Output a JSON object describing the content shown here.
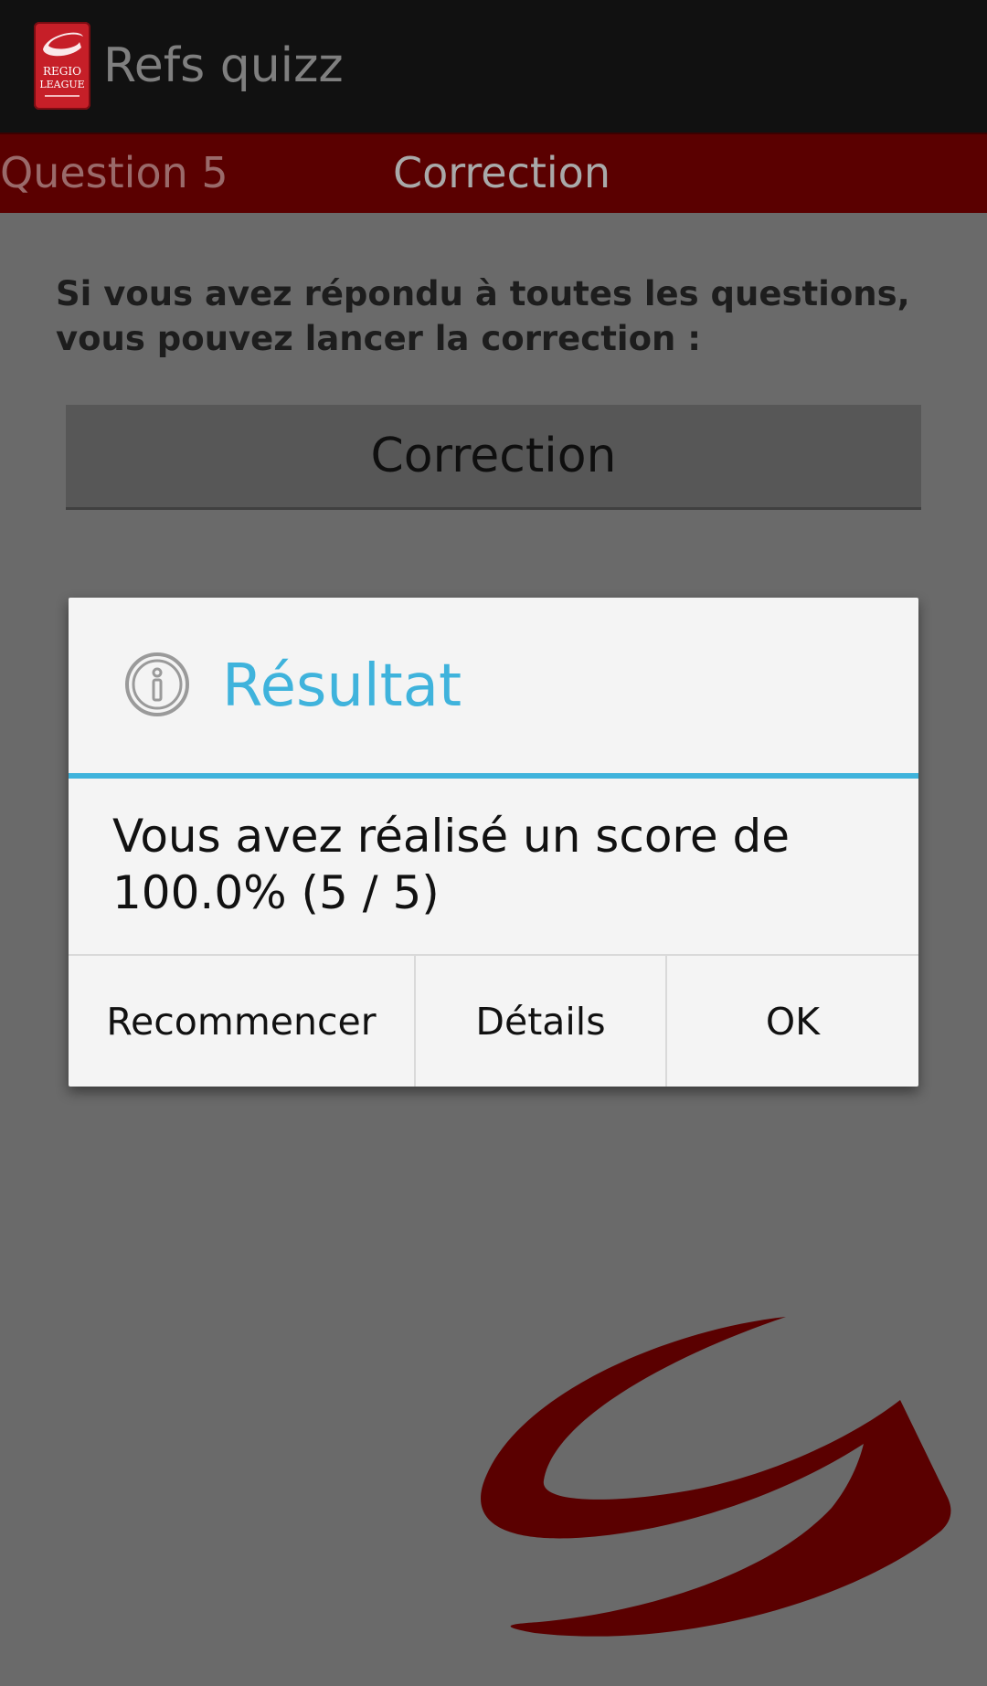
{
  "app": {
    "title": "Refs quizz",
    "logo_text": [
      "REGIO",
      "LEAGUE"
    ],
    "logo_color": "#c61f28"
  },
  "tabs": [
    {
      "label": "Question 5"
    },
    {
      "label": "Correction"
    }
  ],
  "content": {
    "instruction": "Si vous avez répondu à toutes les questions, vous pouvez lancer la correction :",
    "correction_button": "Correction"
  },
  "dialog": {
    "icon": "info-icon",
    "title": "Résultat",
    "message": "Vous avez réalisé un score de 100.0% (5 / 5)",
    "buttons": {
      "restart": "Recommencer",
      "details": "Détails",
      "ok": "OK"
    },
    "accent_color": "#3fb3dc"
  },
  "colors": {
    "tab_strip": "#5a0000",
    "action_bar": "#111111",
    "background_dim": "#6a6a6a",
    "watermark": "#5a0000"
  }
}
